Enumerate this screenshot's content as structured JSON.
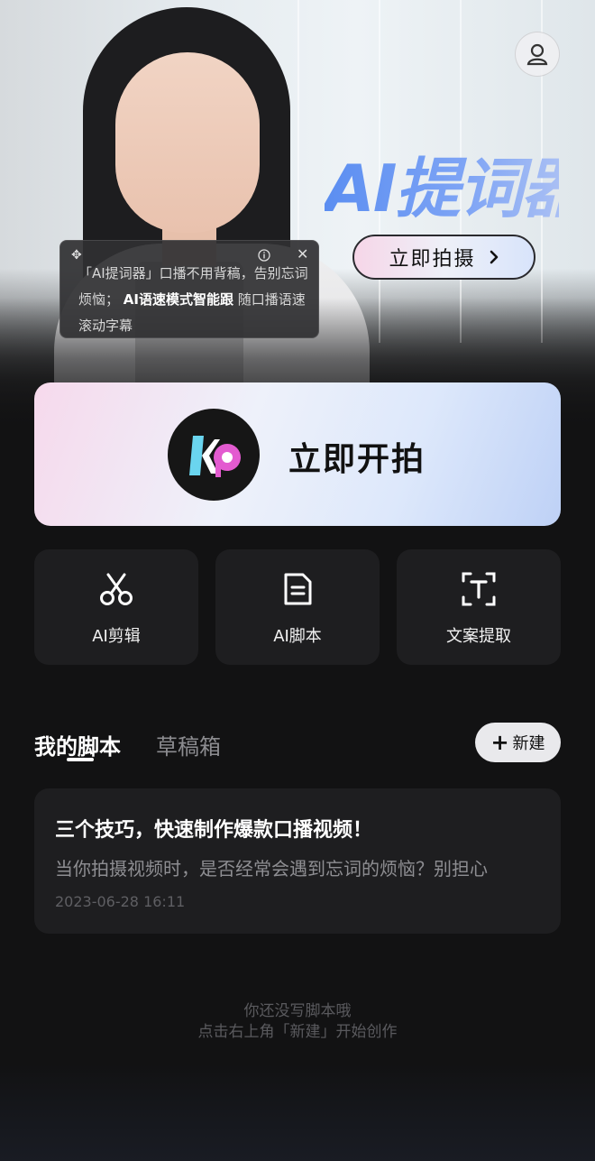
{
  "hero": {
    "title": "AI提词器",
    "shoot_label": "立即拍摄",
    "tip": {
      "text_plain": "「AI提词器」口播不用背稿，告别忘词烦恼；",
      "text_bold": "AI语速模式智能跟",
      "text_cut": "随口播语速滚动字幕"
    }
  },
  "start": {
    "label": "立即开拍"
  },
  "tools": [
    {
      "label": "AI剪辑",
      "icon": "scissors-icon"
    },
    {
      "label": "AI脚本",
      "icon": "document-icon"
    },
    {
      "label": "文案提取",
      "icon": "text-extract-icon"
    }
  ],
  "tabs": {
    "active": "我的脚本",
    "inactive": "草稿箱"
  },
  "new_button": {
    "label": "新建"
  },
  "script": {
    "title": "三个技巧，快速制作爆款口播视频！",
    "desc": "当你拍摄视频时，是否经常会遇到忘词的烦恼？别担心",
    "time": "2023-06-28 16:11"
  },
  "empty": {
    "line1": "你还没写脚本哦",
    "line2": "点击右上角「新建」开始创作"
  },
  "colors": {
    "background": "#121213",
    "card": "#1e1e20",
    "accent_blue": "#5b8ef1",
    "accent_pink": "#e35bd0"
  }
}
